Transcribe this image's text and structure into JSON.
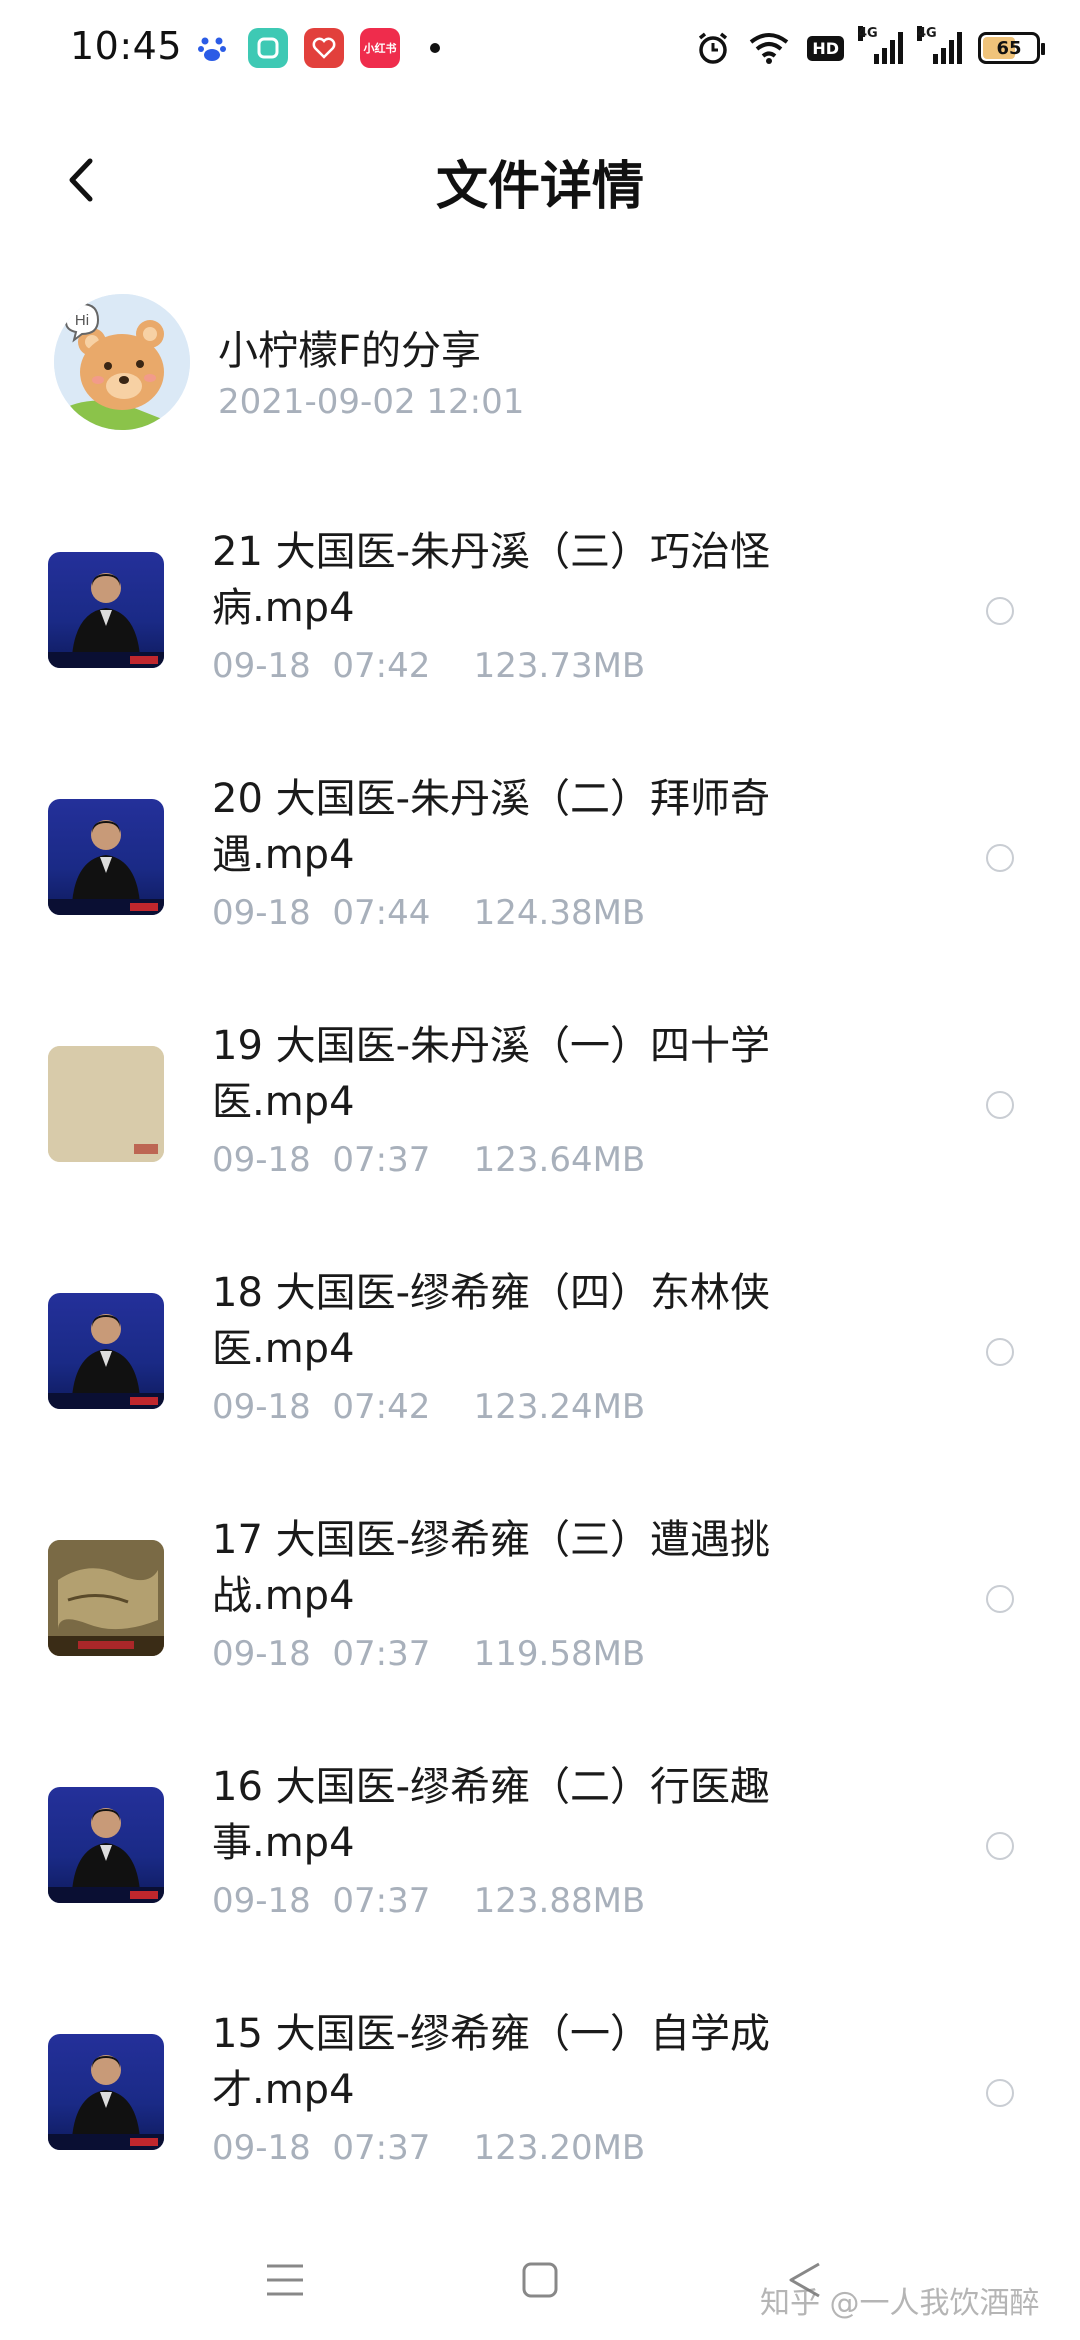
{
  "status_bar": {
    "time": "10:45",
    "apps": [
      "baidu",
      "green-app",
      "heart-app",
      "xiaohongshu"
    ],
    "app_labels": {
      "red": "小红书"
    },
    "hd_badge": "HD",
    "signal1_label": "4G",
    "signal2_label": "4G",
    "battery_level": "65",
    "battery_fraction": 0.65
  },
  "header": {
    "title": "文件详情"
  },
  "sharer": {
    "name": "小柠檬F的分享",
    "time": "2021-09-02  12:01"
  },
  "files": [
    {
      "name": "21 大国医-朱丹溪（三）巧治怪病.mp4",
      "meta": "09-18  07:42    123.73MB",
      "thumb": "host"
    },
    {
      "name": "20 大国医-朱丹溪（二）拜师奇遇.mp4",
      "meta": "09-18  07:44    124.38MB",
      "thumb": "host"
    },
    {
      "name": "19 大国医-朱丹溪（一）四十学医.mp4",
      "meta": "09-18  07:37    123.64MB",
      "thumb": "scroll"
    },
    {
      "name": "18 大国医-缪希雍（四）东林侠医.mp4",
      "meta": "09-18  07:42    123.24MB",
      "thumb": "host"
    },
    {
      "name": "17 大国医-缪希雍（三）遭遇挑战.mp4",
      "meta": "09-18  07:37    119.58MB",
      "thumb": "map"
    },
    {
      "name": "16 大国医-缪希雍（二）行医趣事.mp4",
      "meta": "09-18  07:37    123.88MB",
      "thumb": "host"
    },
    {
      "name": "15 大国医-缪希雍（一）自学成才.mp4",
      "meta": "09-18  07:37    123.20MB",
      "thumb": "host"
    }
  ],
  "watermark": "知乎 @一人我饮酒醉",
  "colors": {
    "meta_text": "#a8b0bb",
    "thumb_blue": "#1a2a86",
    "radio_border": "#c9cdd3"
  }
}
